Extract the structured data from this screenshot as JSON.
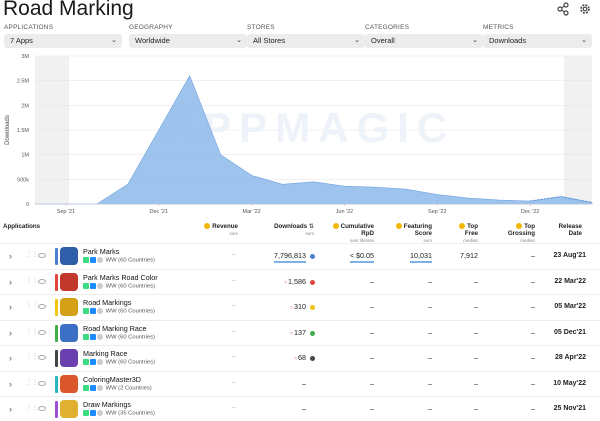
{
  "title": "Road Marking",
  "filters": [
    {
      "label": "APPLICATIONS",
      "value": "7 Apps"
    },
    {
      "label": "GEOGRAPHY",
      "value": "Worldwide"
    },
    {
      "label": "STORES",
      "value": "All Stores"
    },
    {
      "label": "CATEGORIES",
      "value": "Overall"
    },
    {
      "label": "METRICS",
      "value": "Downloads"
    }
  ],
  "chart_data": {
    "type": "area",
    "ylabel": "Downloads",
    "watermark": "APPMAGIC",
    "yticks": [
      "0",
      "500k",
      "1M",
      "1.5M",
      "2M",
      "2.5M",
      "3M"
    ],
    "ylim": [
      0,
      3000000
    ],
    "xticks": [
      "Sep '21",
      "Dec '21",
      "Mar '22",
      "Jun '22",
      "Sep '22",
      "Dec '22"
    ],
    "x": [
      "Aug '21",
      "Sep '21",
      "Oct '21",
      "Nov '21",
      "Dec '21",
      "Jan '22",
      "Feb '22",
      "Mar '22",
      "Apr '22",
      "May '22",
      "Jun '22",
      "Jul '22",
      "Aug '22",
      "Sep '22",
      "Oct '22",
      "Nov '22",
      "Dec '22",
      "Jan '23",
      "Feb '23"
    ],
    "values": [
      0,
      0,
      0,
      400000,
      1500000,
      2600000,
      1000000,
      580000,
      400000,
      450000,
      360000,
      340000,
      300000,
      190000,
      120000,
      80000,
      60000,
      150000,
      30000
    ],
    "color": "#8db8ea"
  },
  "table": {
    "headers": {
      "applications": "Applications",
      "revenue": "Revenue",
      "revenue_sub": "sum",
      "downloads": "Downloads",
      "downloads_sub": "sum",
      "rpd": "Cumulative RpD",
      "rpd_sub": "over lifetime",
      "featuring": "Featuring Score",
      "featuring_sub": "sum",
      "topfree": "Top Free",
      "topfree_sub": "median",
      "topgrossing": "Top Grossing",
      "topgrossing_sub": "median",
      "release": "Release Date"
    },
    "rows": [
      {
        "name": "Park Marks",
        "stores": "WW (60 Countries)",
        "revenue": "–",
        "downloads": "7,796,813",
        "rpd": "< $0.05",
        "featuring": "10,031",
        "topfree": "7,912",
        "topgrossing": "–",
        "release": "23 Aug'21",
        "bar": "#4a7fd4",
        "dot": "#4a7fd4",
        "icon": "#2e5fa8"
      },
      {
        "name": "Park Marks Road Color",
        "stores": "WW (60 Countries)",
        "revenue": "–",
        "downloads": "1,586",
        "rpd": "–",
        "featuring": "–",
        "topfree": "–",
        "topgrossing": "–",
        "release": "22 Mar'22",
        "bar": "#e0463c",
        "dot": "#e0463c",
        "icon": "#c0392b"
      },
      {
        "name": "Road Markings",
        "stores": "WW (60 Countries)",
        "revenue": "–",
        "downloads": "310",
        "rpd": "–",
        "featuring": "–",
        "topfree": "–",
        "topgrossing": "–",
        "release": "05 Mar'22",
        "bar": "#f2c511",
        "dot": "#f2c511",
        "icon": "#d4a017"
      },
      {
        "name": "Road Marking Race",
        "stores": "WW (60 Countries)",
        "revenue": "–",
        "downloads": "137",
        "rpd": "–",
        "featuring": "–",
        "topfree": "–",
        "topgrossing": "–",
        "release": "05 Dec'21",
        "bar": "#3fae49",
        "dot": "#3fae49",
        "icon": "#3a6fc4"
      },
      {
        "name": "Marking Race",
        "stores": "WW (60 Countries)",
        "revenue": "–",
        "downloads": "68",
        "rpd": "–",
        "featuring": "–",
        "topfree": "–",
        "topgrossing": "–",
        "release": "28 Apr'22",
        "bar": "#444444",
        "dot": "#444444",
        "icon": "#6a3fb0"
      },
      {
        "name": "ColoringMaster3D",
        "stores": "WW (2 Countries)",
        "revenue": "–",
        "downloads": "–",
        "rpd": "–",
        "featuring": "–",
        "topfree": "–",
        "topgrossing": "–",
        "release": "10 May'22",
        "bar": "#2bb3c0",
        "dot": "",
        "icon": "#d9572b"
      },
      {
        "name": "Draw Markings",
        "stores": "WW (35 Countries)",
        "revenue": "–",
        "downloads": "–",
        "rpd": "–",
        "featuring": "–",
        "topfree": "–",
        "topgrossing": "–",
        "release": "25 Nov'21",
        "bar": "#9c4fd1",
        "dot": "",
        "icon": "#e0b030"
      }
    ]
  }
}
